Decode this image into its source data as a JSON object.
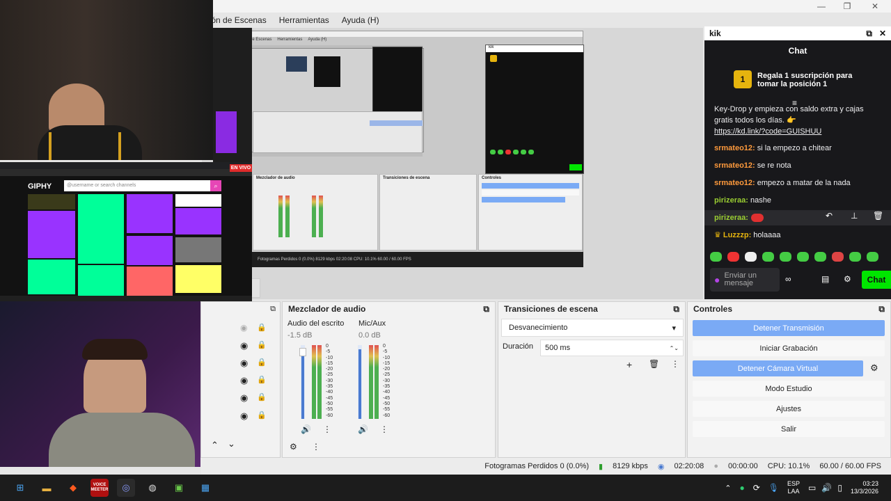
{
  "menu": {
    "items": [
      "ición de Escenas",
      "Herramientas",
      "Ayuda (H)"
    ]
  },
  "nested": {
    "menu": [
      "ación de Escenas",
      "Herramientas",
      "Ayuda (H)"
    ],
    "status": "Fotogramas Perdidos 0 (0.0%)   8129 kbps   02:20:08   CPU: 10.1%   60.00 / 60.00 FPS",
    "mixer_title": "Mezclador de audio",
    "transitions_title": "Transiciones de escena",
    "controls_title": "Controles",
    "chat_title": "kik"
  },
  "giphy": {
    "logo": "GIPHY",
    "search_placeholder": "@username or search channels",
    "live": "EN VIVO"
  },
  "chat": {
    "window_title": "kik",
    "title": "Chat",
    "promo": "Regala 1 suscripción para tomar la posición 1",
    "messages": [
      {
        "user": "",
        "text": "Key-Drop y empieza con saldo extra y cajas gratis todos los días. 👉"
      },
      {
        "user": "",
        "text": "https://kd.link/?code=GUISHUU"
      },
      {
        "user": "srmateo12:",
        "text": " si la empezo a chitear"
      },
      {
        "user": "srmateo12:",
        "text": " se re nota"
      },
      {
        "user": "srmateo12:",
        "text": " empezo a matar de la nada"
      },
      {
        "user": "pirizeraa:",
        "text": " nashe"
      },
      {
        "user": "pirizeraa:",
        "text": ""
      },
      {
        "user": "Luzzzp:",
        "text": " holaaaa"
      }
    ],
    "input_placeholder": "Enviar un mensaje",
    "send": "Chat"
  },
  "mixer": {
    "title": "Mezclador de audio",
    "ch1": {
      "name": "Audio del escrito",
      "db": "-1.5 dB",
      "level": 0.8
    },
    "ch2": {
      "name": "Mic/Aux",
      "db": "0.0 dB",
      "level": 0.75
    },
    "scale": [
      "0",
      "-5",
      "-10",
      "-15",
      "-20",
      "-25",
      "-30",
      "-35",
      "-40",
      "-45",
      "-50",
      "-55",
      "-60"
    ]
  },
  "transitions": {
    "title": "Transiciones de escena",
    "selected": "Desvanecimiento",
    "duration_label": "Duración",
    "duration_value": "500 ms"
  },
  "controls": {
    "title": "Controles",
    "stop_stream": "Detener Transmisión",
    "start_rec": "Iniciar Grabación",
    "stop_vcam": "Detener Cámara Virtual",
    "studio": "Modo Estudio",
    "settings": "Ajustes",
    "exit": "Salir"
  },
  "status": {
    "dropped": "Fotogramas Perdidos 0 (0.0%)",
    "kbps": "8129 kbps",
    "stream_time": "02:20:08",
    "rec_time": "00:00:00",
    "cpu": "CPU: 10.1%",
    "fps": "60.00 / 60.00 FPS"
  },
  "taskbar": {
    "lang1": "ESP",
    "lang2": "LAA",
    "time": "03:23",
    "date": "13/3/2026",
    "app_voicemeeter": "VOICE MEETER"
  },
  "colors": {
    "accent": "#7aaaf5",
    "chat_bg": "#18181b",
    "twitch_green": "#00e600"
  }
}
